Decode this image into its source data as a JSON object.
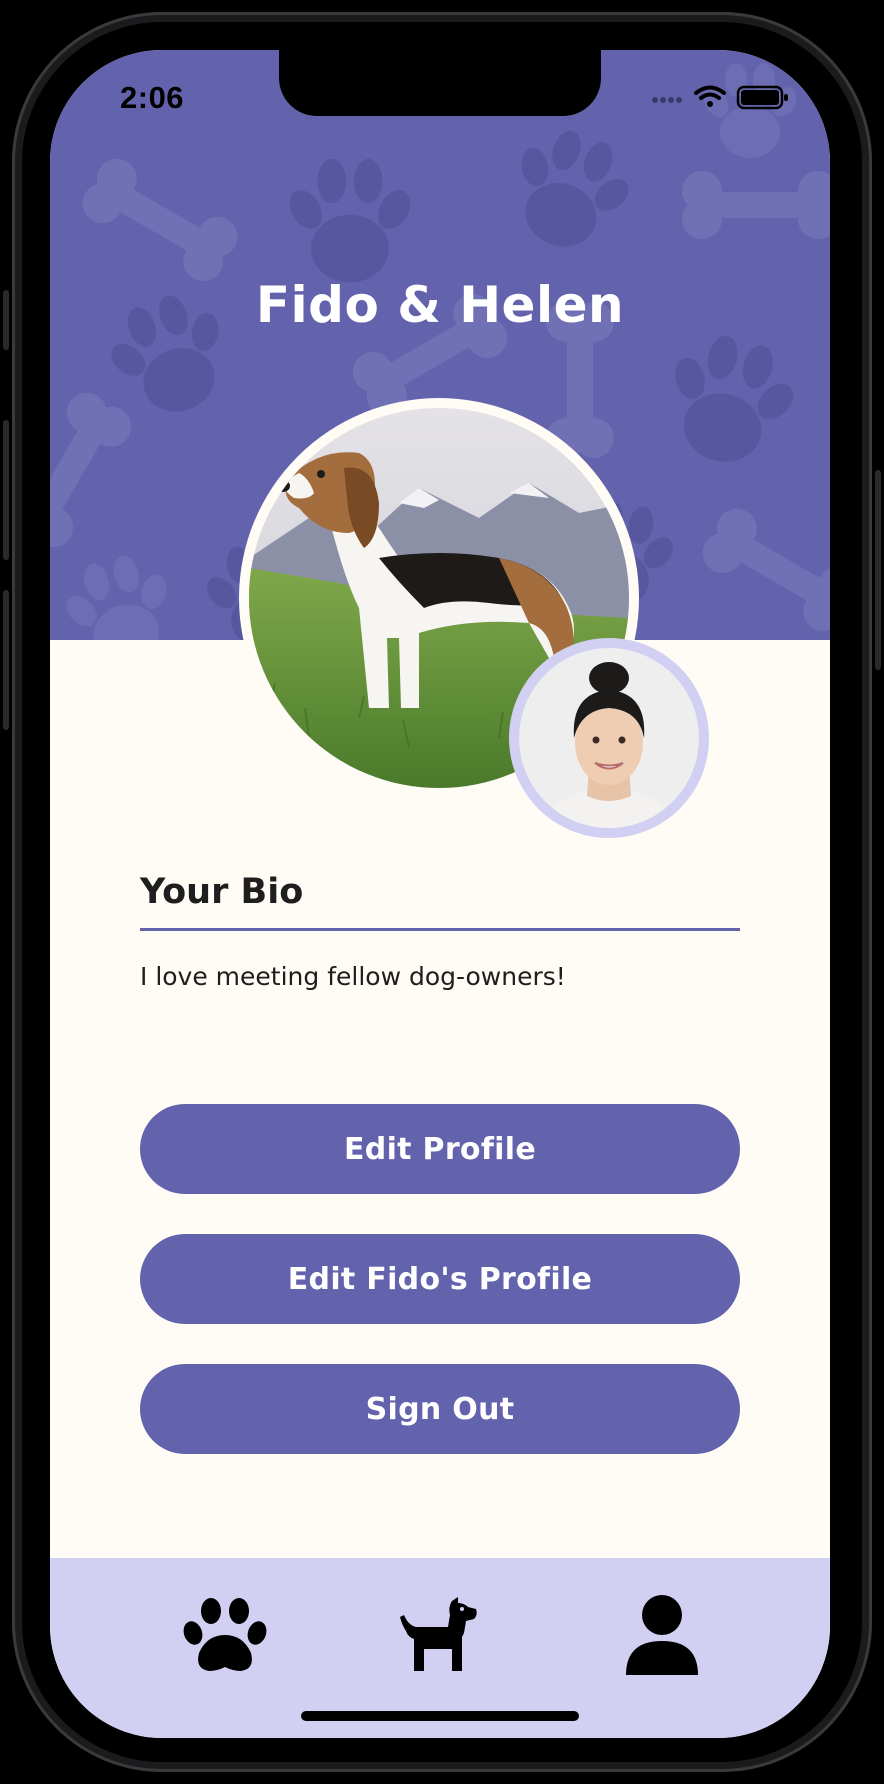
{
  "status_bar": {
    "time": "2:06",
    "icons": [
      "dots-icon",
      "wifi-icon",
      "battery-icon"
    ]
  },
  "header": {
    "title": "Fido & Helen",
    "background_color": "#6363ad",
    "pattern_icons": [
      "bone-icon",
      "paw-icon"
    ]
  },
  "photos": {
    "dog": "beagle-photo",
    "owner": "owner-photo"
  },
  "bio": {
    "title": "Your Bio",
    "text": "I love meeting fellow dog-owners!"
  },
  "buttons": {
    "edit_profile": "Edit Profile",
    "edit_dog_profile": "Edit Fido's Profile",
    "sign_out": "Sign Out"
  },
  "tab_bar": {
    "tabs": [
      {
        "icon": "paw-icon"
      },
      {
        "icon": "dog-icon"
      },
      {
        "icon": "person-icon"
      }
    ],
    "background_color": "#d2d0f2"
  },
  "colors": {
    "accent": "#6363ad",
    "page_background": "#fffbf5",
    "tabbar_background": "#d2d0f2",
    "text": "#1e1e1e"
  }
}
